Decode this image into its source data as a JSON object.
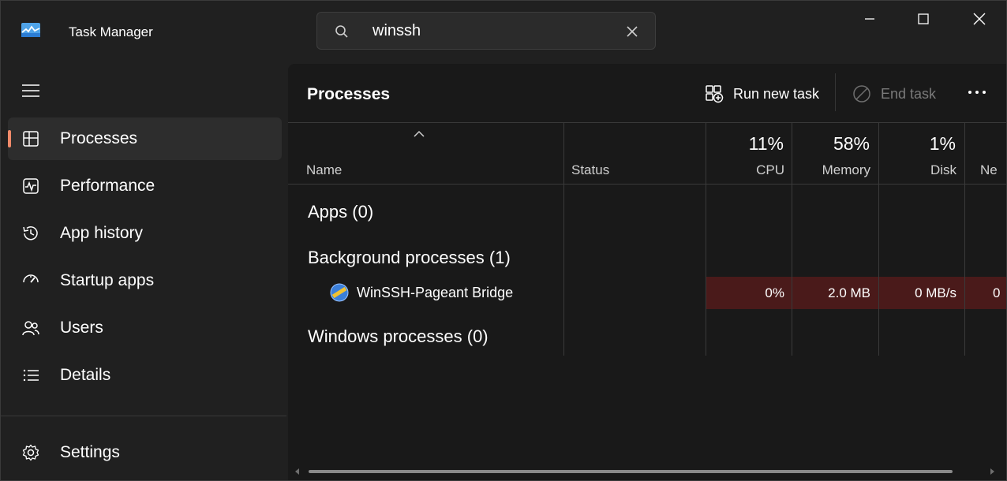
{
  "app": {
    "title": "Task Manager"
  },
  "search": {
    "value": "winssh",
    "placeholder": ""
  },
  "sidebar": {
    "items": [
      {
        "label": "Processes",
        "icon": "processes-icon",
        "active": true
      },
      {
        "label": "Performance",
        "icon": "performance-icon"
      },
      {
        "label": "App history",
        "icon": "app-history-icon"
      },
      {
        "label": "Startup apps",
        "icon": "startup-apps-icon"
      },
      {
        "label": "Users",
        "icon": "users-icon"
      },
      {
        "label": "Details",
        "icon": "details-icon"
      }
    ],
    "settings": {
      "label": "Settings",
      "icon": "gear-icon"
    }
  },
  "main": {
    "title": "Processes",
    "toolbar": {
      "run_new_task": "Run new task",
      "end_task": "End task"
    },
    "columns": {
      "name": "Name",
      "status": "Status",
      "cpu": {
        "label": "CPU",
        "percent": "11%"
      },
      "memory": {
        "label": "Memory",
        "percent": "58%"
      },
      "disk": {
        "label": "Disk",
        "percent": "1%"
      },
      "network": {
        "label": "Ne"
      }
    },
    "groups": {
      "apps": "Apps (0)",
      "background": "Background processes (1)",
      "windows": "Windows processes (0)"
    },
    "rows": [
      {
        "name": "WinSSH-Pageant Bridge",
        "cpu": "0%",
        "memory": "2.0 MB",
        "disk": "0 MB/s",
        "network": "0"
      }
    ]
  },
  "colors": {
    "accent": "#f08a6a",
    "heat": "#4a1a1a",
    "background": "#202020",
    "panel": "#191919"
  }
}
